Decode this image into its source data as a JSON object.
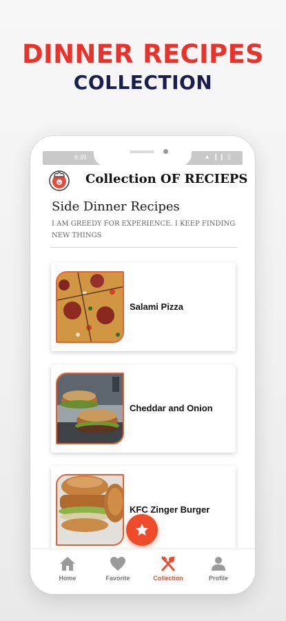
{
  "hero": {
    "title": "DINNER RECIPES",
    "subtitle": "COLLECTION"
  },
  "status_bar": {
    "time": "6:39",
    "icons": "▲ ❙❙ ▯"
  },
  "app_bar": {
    "title": "Collection OF RECIEPS"
  },
  "section": {
    "title": "Side Dinner Recipes",
    "description": "I AM GREEDY FOR EXPERIENCE. I KEEP FINDING NEW THINGS"
  },
  "recipes": [
    {
      "name": "Salami Pizza",
      "image": "pizza-photo"
    },
    {
      "name": "Cheddar and Onion",
      "image": "burger-photo"
    },
    {
      "name": "KFC Zinger Burger",
      "image": "zinger-photo"
    }
  ],
  "nav": {
    "items": [
      {
        "label": "Home",
        "icon": "home-icon"
      },
      {
        "label": "Favorite",
        "icon": "heart-icon"
      },
      {
        "label": "Collection",
        "icon": "fork-spoon-icon"
      },
      {
        "label": "Profile",
        "icon": "person-icon"
      }
    ],
    "active_index": 2,
    "fab_icon": "star-icon"
  },
  "colors": {
    "accent": "#ee4b2b",
    "hero_red": "#e8322a",
    "hero_navy": "#1b1d4d",
    "nav_inactive": "#777777"
  }
}
